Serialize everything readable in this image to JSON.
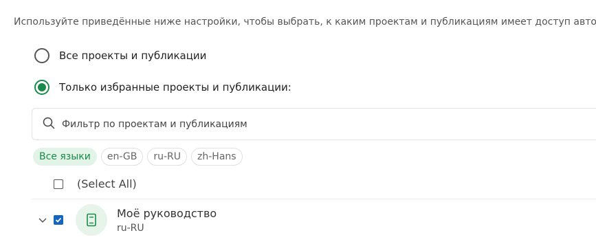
{
  "intro_text": "Используйте приведённые ниже настройки, чтобы выбрать, к каким проектам и публикациям имеет доступ автор.",
  "options": {
    "all_label": "Все проекты и публикации",
    "selected_label": "Только избранные проекты и публикации:",
    "selected_option": "selected"
  },
  "search": {
    "placeholder": "Фильтр по проектам и публикациям",
    "value": ""
  },
  "language_filters": [
    {
      "label": "Все языки",
      "active": true
    },
    {
      "label": "en-GB",
      "active": false
    },
    {
      "label": "ru-RU",
      "active": false
    },
    {
      "label": "zh-Hans",
      "active": false
    }
  ],
  "select_all": {
    "label": "(Select All)",
    "checked": false
  },
  "projects": [
    {
      "title": "Моё руководство",
      "language": "ru-RU",
      "checked": true,
      "icon": "book-icon"
    }
  ],
  "colors": {
    "accent_green": "#1a8a4a",
    "checkbox_blue": "#1565c0",
    "chip_active_bg": "#e2f3e8"
  }
}
